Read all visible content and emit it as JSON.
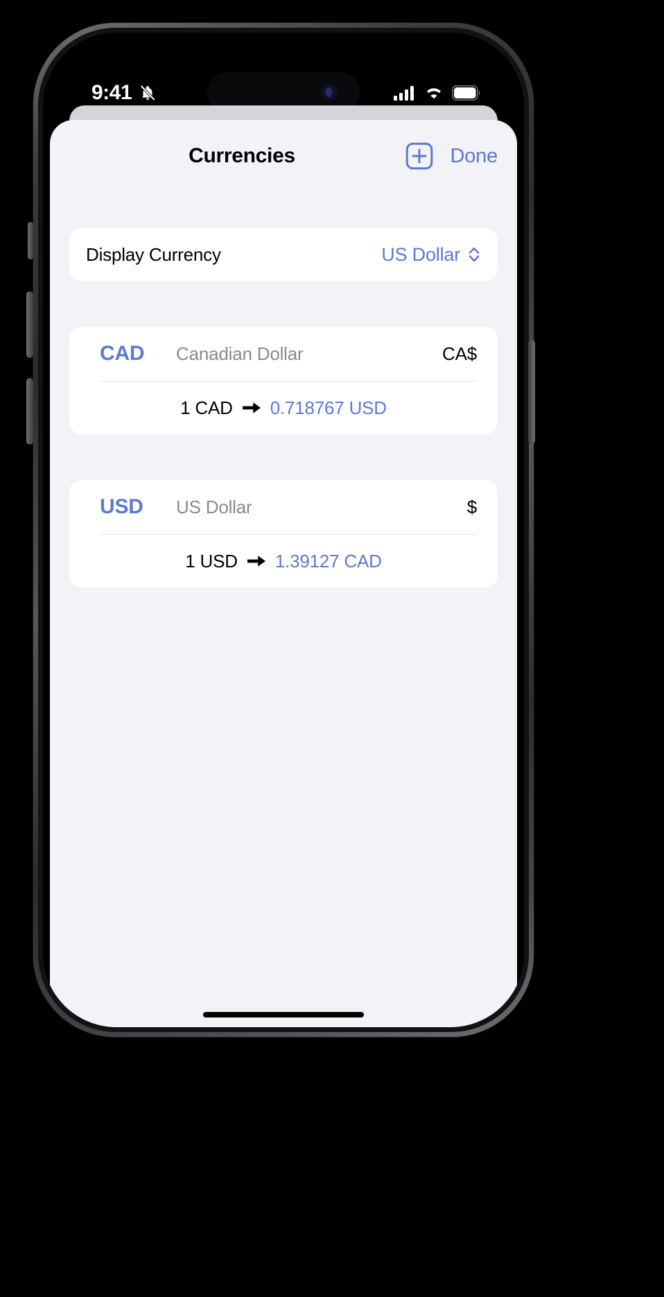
{
  "status_bar": {
    "time": "9:41",
    "bell_icon": "bell-slash-icon",
    "cellular_icon": "cellular-bars-icon",
    "wifi_icon": "wifi-icon",
    "battery_icon": "battery-full-icon"
  },
  "sheet": {
    "title": "Currencies",
    "add_label": "+",
    "add_icon": "plus-square-icon",
    "done_label": "Done"
  },
  "display_currency": {
    "label": "Display Currency",
    "value": "US Dollar",
    "chevron_icon": "chevron-up-down-icon"
  },
  "currencies": [
    {
      "code": "CAD",
      "name": "Canadian Dollar",
      "symbol": "CA$",
      "rate_from": "1 CAD",
      "rate_to": "0.718767 USD",
      "arrow_icon": "arrow-right-icon"
    },
    {
      "code": "USD",
      "name": "US Dollar",
      "symbol": "$",
      "rate_from": "1 USD",
      "rate_to": "1.39127 CAD",
      "arrow_icon": "arrow-right-icon"
    }
  ],
  "colors": {
    "accent": "#5b79d6",
    "sheet_background": "#f2f2f7",
    "card_background": "#ffffff",
    "secondary_text": "#8a8a8e"
  }
}
